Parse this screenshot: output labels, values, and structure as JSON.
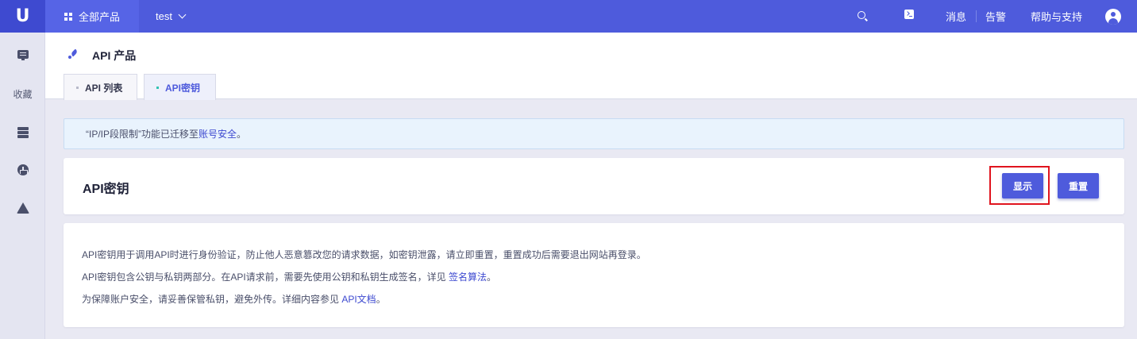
{
  "topbar": {
    "logo_text": "U",
    "all_products": "全部产品",
    "project": "test",
    "messages": "消息",
    "alerts": "告警",
    "help": "帮助与支持"
  },
  "sidebar": {
    "favorites_label": "收藏"
  },
  "page": {
    "title": "API 产品",
    "tabs": [
      {
        "label": "API 列表",
        "active": false
      },
      {
        "label": "API密钥",
        "active": true
      }
    ]
  },
  "notice": {
    "text": "“IP/IP段限制”功能已迁移至",
    "link": "账号安全",
    "suffix": "。"
  },
  "key_card": {
    "title": "API密钥",
    "show_button": "显示",
    "reset_button": "重置"
  },
  "description": {
    "line1": "API密钥用于调用API时进行身份验证，防止他人恶意篡改您的请求数据，如密钥泄露，请立即重置，重置成功后需要退出网站再登录。",
    "line2_prefix": "API密钥包含公钥与私钥两部分。在API请求前，需要先使用公钥和私钥生成签名，详见 ",
    "line2_link": "签名算法",
    "line2_suffix": "。",
    "line3_prefix": "为保障账户安全，请妥善保管私钥，避免外传。详细内容参见 ",
    "line3_link": "API文档",
    "line3_suffix": "。"
  },
  "colors": {
    "brand": "#4e5bdc",
    "highlight_box": "#e0141e",
    "link": "#3e4ad0"
  }
}
